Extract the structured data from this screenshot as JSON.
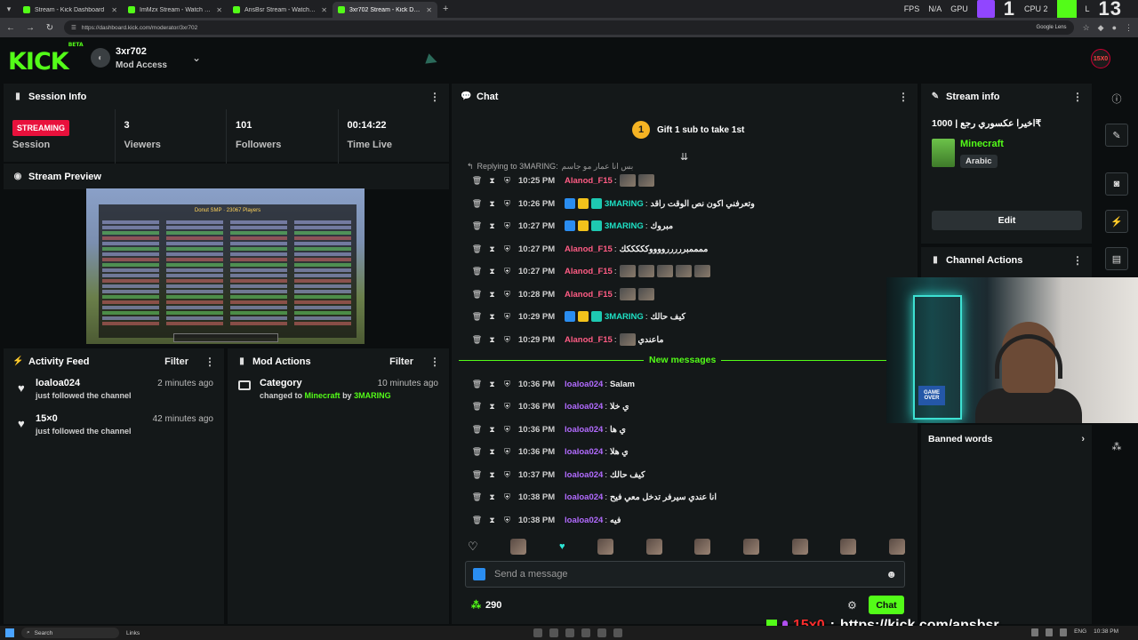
{
  "browser": {
    "tabs": [
      {
        "title": "Stream - Kick Dashboard",
        "active": false
      },
      {
        "title": "ImMzx Stream - Watch Live on",
        "active": false
      },
      {
        "title": "AnsBsr Stream - Watch Live",
        "active": false
      },
      {
        "title": "3xr702 Stream - Kick Dashboard",
        "active": true
      }
    ],
    "url": "https://dashboard.kick.com/moderator/3xr702",
    "lens_label": "Google Lens"
  },
  "overlay_top": {
    "fps_label": "FPS",
    "fps_value": "N/A",
    "gpu_label": "GPU",
    "cpu_label": "CPU 2",
    "l_label": "L",
    "big_left": "1",
    "big_right": "13"
  },
  "header": {
    "logo": "KICK",
    "logo_tag": "BETA",
    "channel_name": "3xr702",
    "channel_role": "Mod Access",
    "user_avatar_text": "15X0"
  },
  "session": {
    "title": "Session Info",
    "status_badge": "STREAMING",
    "status_label": "Session",
    "viewers_value": "3",
    "viewers_label": "Viewers",
    "followers_value": "101",
    "followers_label": "Followers",
    "time_value": "00:14:22",
    "time_label": "Time Live"
  },
  "preview": {
    "title": "Stream Preview",
    "tab_title": "Donut SMP",
    "players": "23067 Players"
  },
  "activity": {
    "title": "Activity Feed",
    "filter": "Filter",
    "items": [
      {
        "user": "loaloa024",
        "action": "just followed the channel",
        "time": "2 minutes ago"
      },
      {
        "user": "15×0",
        "action": "just followed the channel",
        "time": "42 minutes ago"
      }
    ]
  },
  "mod_actions": {
    "title": "Mod Actions",
    "filter": "Filter",
    "item": {
      "type": "Category",
      "prefix": "changed to",
      "game": "Minecraft",
      "by": "by",
      "user": "3MARING",
      "time": "10 minutes ago"
    }
  },
  "chat": {
    "title": "Chat",
    "pinned_coin": "1",
    "pinned_text": "Gift 1 sub to take 1st",
    "reply_prefix": "Replying to 3MARING:",
    "reply_text": "بس انا عمار مو جاسم",
    "new_messages_label": "New messages",
    "messages": [
      {
        "time": "10:25 PM",
        "user": "Alanod_F15",
        "color": "#ff5c84",
        "text": "",
        "badges": [],
        "emotes": 2
      },
      {
        "time": "10:26 PM",
        "user": "3MARING",
        "color": "#1ee0c4",
        "text": "وتعرفني اكون نص الوقت راقد",
        "badges": [
          "blue",
          "gold",
          "teal"
        ],
        "emotes": 0
      },
      {
        "time": "10:27 PM",
        "user": "3MARING",
        "color": "#1ee0c4",
        "text": "مبروك",
        "badges": [
          "blue",
          "gold",
          "teal"
        ],
        "emotes": 0
      },
      {
        "time": "10:27 PM",
        "user": "Alanod_F15",
        "color": "#ff5c84",
        "text": "ممممبرررررووووكككككك",
        "badges": [],
        "emotes": 0
      },
      {
        "time": "10:27 PM",
        "user": "Alanod_F15",
        "color": "#ff5c84",
        "text": "",
        "badges": [],
        "emotes": 5
      },
      {
        "time": "10:28 PM",
        "user": "Alanod_F15",
        "color": "#ff5c84",
        "text": "",
        "badges": [],
        "emotes": 2
      },
      {
        "time": "10:29 PM",
        "user": "3MARING",
        "color": "#1ee0c4",
        "text": "كيف حالك",
        "badges": [
          "blue",
          "gold",
          "teal"
        ],
        "emotes": 0
      },
      {
        "time": "10:29 PM",
        "user": "Alanod_F15",
        "color": "#ff5c84",
        "text": "ماعندي",
        "badges": [],
        "emotes": 1
      },
      {
        "time": "10:36 PM",
        "user": "loaloa024",
        "color": "#b26bff",
        "text": "Salam",
        "badges": [],
        "emotes": 0
      },
      {
        "time": "10:36 PM",
        "user": "loaloa024",
        "color": "#b26bff",
        "text": "ي خلا",
        "badges": [],
        "emotes": 0
      },
      {
        "time": "10:36 PM",
        "user": "loaloa024",
        "color": "#b26bff",
        "text": "ي ها",
        "badges": [],
        "emotes": 0
      },
      {
        "time": "10:36 PM",
        "user": "loaloa024",
        "color": "#b26bff",
        "text": "ي هلا",
        "badges": [],
        "emotes": 0
      },
      {
        "time": "10:37 PM",
        "user": "loaloa024",
        "color": "#b26bff",
        "text": "كيف حالك",
        "badges": [],
        "emotes": 0
      },
      {
        "time": "10:38 PM",
        "user": "loaloa024",
        "color": "#b26bff",
        "text": "انا عندي سيرفر تدخل معي فيح",
        "badges": [],
        "emotes": 0
      },
      {
        "time": "10:38 PM",
        "user": "loaloa024",
        "color": "#b26bff",
        "text": "فيه",
        "badges": [],
        "emotes": 0
      }
    ],
    "input_placeholder": "Send a message",
    "points": "290",
    "send_label": "Chat"
  },
  "stream_info": {
    "title": "Stream info",
    "stream_title": "اخيرا عكسوري رجع | 1000₹",
    "game": "Minecraft",
    "tag": "Arabic",
    "edit_label": "Edit"
  },
  "channel_actions": {
    "title": "Channel Actions"
  },
  "banned_words": {
    "title": "Banned words"
  },
  "webcam": {
    "sign": "GAME OVER"
  },
  "overlay_bottom": {
    "handle": "15x0",
    "link": "https://kick.com/ansbsr"
  },
  "taskbar": {
    "search": "Search",
    "links": "Links",
    "lang": "ENG",
    "clock": "10:38 PM"
  },
  "colors": {
    "kick_green": "#53fc18",
    "live_red": "#e9113c",
    "panel": "#141819",
    "bg": "#0b0e0f"
  }
}
